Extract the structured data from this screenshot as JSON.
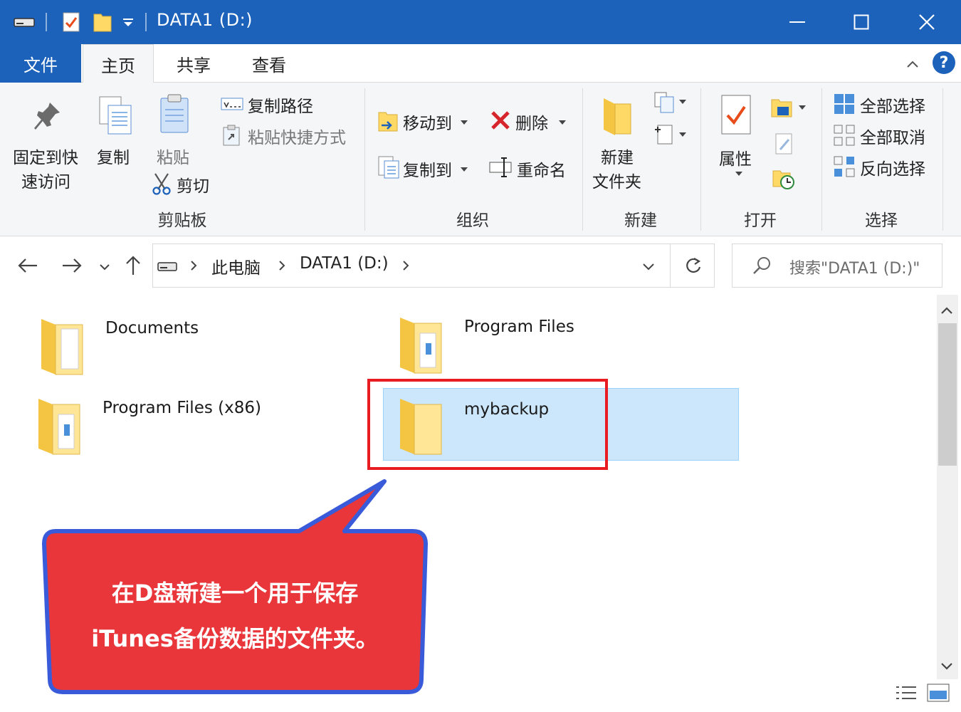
{
  "window": {
    "title": "DATA1 (D:)",
    "accent_color": "#1c62ba"
  },
  "ribbon_tabs": {
    "file": "文件",
    "home": "主页",
    "share": "共享",
    "view": "查看"
  },
  "clipboard": {
    "pin_line1": "固定到快",
    "pin_line2": "速访问",
    "copy": "复制",
    "paste": "粘贴",
    "copy_path": "复制路径",
    "paste_shortcut": "粘贴快捷方式",
    "cut": "剪切",
    "group_label": "剪贴板"
  },
  "organize": {
    "move_to": "移动到",
    "delete": "删除",
    "copy_to": "复制到",
    "rename": "重命名",
    "group_label": "组织"
  },
  "new_group": {
    "new_folder_line1": "新建",
    "new_folder_line2": "文件夹",
    "group_label": "新建"
  },
  "open_group": {
    "properties": "属性",
    "group_label": "打开"
  },
  "select_group": {
    "select_all": "全部选择",
    "select_none": "全部取消",
    "invert_selection": "反向选择",
    "group_label": "选择"
  },
  "address": {
    "crumb_pc": "此电脑",
    "crumb_drive": "DATA1 (D:)",
    "search_placeholder": "搜索\"DATA1 (D:)\""
  },
  "folders": [
    {
      "name": "Documents",
      "icon": "folder-icon"
    },
    {
      "name": "Program Files",
      "icon": "folder-icon"
    },
    {
      "name": "Program Files (x86)",
      "icon": "folder-icon"
    },
    {
      "name": "mybackup",
      "icon": "folder-icon",
      "selected": true
    }
  ],
  "callout": {
    "line1": "在D盘新建一个用于保存",
    "line2": "iTunes备份数据的文件夹。",
    "fill_color": "#e8363a",
    "border_color": "#3a5bd9"
  }
}
